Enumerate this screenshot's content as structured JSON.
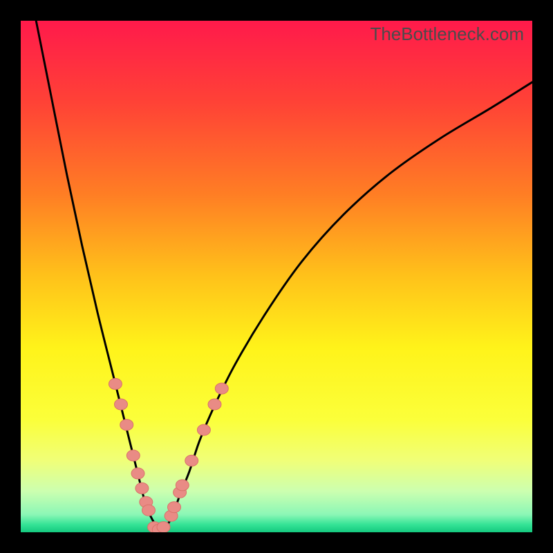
{
  "watermark": "TheBottleneck.com",
  "colors": {
    "frame": "#000000",
    "curve": "#000000",
    "marker_fill": "#e98b85",
    "marker_stroke": "#d9726a",
    "gradient_stops": [
      {
        "offset": 0.0,
        "color": "#ff1a4b"
      },
      {
        "offset": 0.16,
        "color": "#ff4236"
      },
      {
        "offset": 0.34,
        "color": "#ff7e24"
      },
      {
        "offset": 0.5,
        "color": "#ffc21a"
      },
      {
        "offset": 0.64,
        "color": "#fff31a"
      },
      {
        "offset": 0.78,
        "color": "#fbff3a"
      },
      {
        "offset": 0.86,
        "color": "#f0ff78"
      },
      {
        "offset": 0.92,
        "color": "#ccffb0"
      },
      {
        "offset": 0.965,
        "color": "#8cf7b6"
      },
      {
        "offset": 0.985,
        "color": "#35e396"
      },
      {
        "offset": 1.0,
        "color": "#14c97f"
      }
    ]
  },
  "chart_data": {
    "type": "line",
    "title": "",
    "xlabel": "",
    "ylabel": "",
    "xlim": [
      0,
      100
    ],
    "ylim": [
      0,
      100
    ],
    "note": "V-shaped bottleneck curve. x is relative capability/performance index; y is bottleneck percentage. Minimum (~0%) near x≈27. Axes are unlabeled in the source image; values below are read from geometry.",
    "series": [
      {
        "name": "bottleneck-curve",
        "x": [
          3,
          6,
          9,
          12,
          15,
          18,
          20,
          22,
          23,
          24,
          25,
          26,
          27,
          28,
          29,
          30,
          31,
          33,
          35,
          38,
          42,
          48,
          55,
          63,
          72,
          82,
          92,
          100
        ],
        "y": [
          100,
          85,
          70,
          56,
          43,
          31,
          23,
          15,
          11,
          7,
          4,
          2,
          0.5,
          0.5,
          2,
          4,
          7,
          12,
          18,
          25,
          33,
          43,
          53,
          62,
          70,
          77,
          83,
          88
        ]
      }
    ],
    "markers": {
      "name": "highlighted-points",
      "note": "Salmon dots clustered on both inner walls of the V and three along the green floor.",
      "points": [
        {
          "x": 18.5,
          "y": 29
        },
        {
          "x": 19.6,
          "y": 25
        },
        {
          "x": 20.7,
          "y": 21
        },
        {
          "x": 22.0,
          "y": 15
        },
        {
          "x": 22.9,
          "y": 11.5
        },
        {
          "x": 23.7,
          "y": 8.6
        },
        {
          "x": 24.5,
          "y": 5.9
        },
        {
          "x": 25.0,
          "y": 4.3
        },
        {
          "x": 26.1,
          "y": 1.0
        },
        {
          "x": 27.0,
          "y": 0.5
        },
        {
          "x": 27.9,
          "y": 1.0
        },
        {
          "x": 29.4,
          "y": 3.2
        },
        {
          "x": 30.0,
          "y": 4.9
        },
        {
          "x": 31.1,
          "y": 7.8
        },
        {
          "x": 31.6,
          "y": 9.2
        },
        {
          "x": 33.4,
          "y": 14.0
        },
        {
          "x": 35.8,
          "y": 20.0
        },
        {
          "x": 37.9,
          "y": 25.0
        },
        {
          "x": 39.3,
          "y": 28.1
        }
      ]
    }
  }
}
